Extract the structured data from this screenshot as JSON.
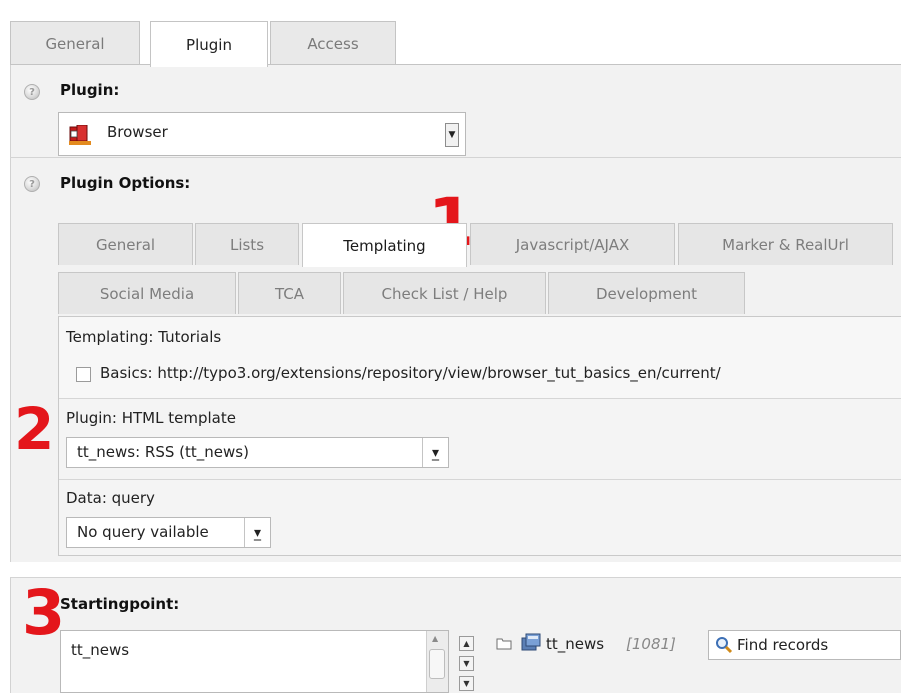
{
  "top_tabs": [
    {
      "label": "General",
      "active": false
    },
    {
      "label": "Plugin",
      "active": true
    },
    {
      "label": "Access",
      "active": false
    }
  ],
  "plugin": {
    "label": "Plugin:",
    "selected": "Browser"
  },
  "plugin_options": {
    "label": "Plugin Options:",
    "tabs_row1": [
      "General",
      "Lists",
      "Templating",
      "Javascript/AJAX",
      "Marker & RealUrl"
    ],
    "tabs_row2": [
      "Social Media",
      "TCA",
      "Check List / Help",
      "Development"
    ],
    "active_tab": "Templating"
  },
  "templating": {
    "tutorials_label": "Templating: Tutorials",
    "basics_checkbox": "Basics: http://typo3.org/extensions/repository/view/browser_tut_basics_en/current/",
    "html_template_label": "Plugin: HTML template",
    "html_template_value": "tt_news: RSS (tt_news)",
    "query_label": "Data: query",
    "query_value": "No query vailable"
  },
  "startingpoint": {
    "label": "Startingpoint:",
    "list_item": "tt_news",
    "record_title": "tt_news",
    "record_id": "[1081]",
    "find_records": "Find records"
  },
  "annotations": [
    "1",
    "2",
    "3"
  ],
  "colors": {
    "annotation_red": "#e4161b",
    "section_bg": "#f2f2f2",
    "tab_inactive": "#e6e6e6"
  }
}
